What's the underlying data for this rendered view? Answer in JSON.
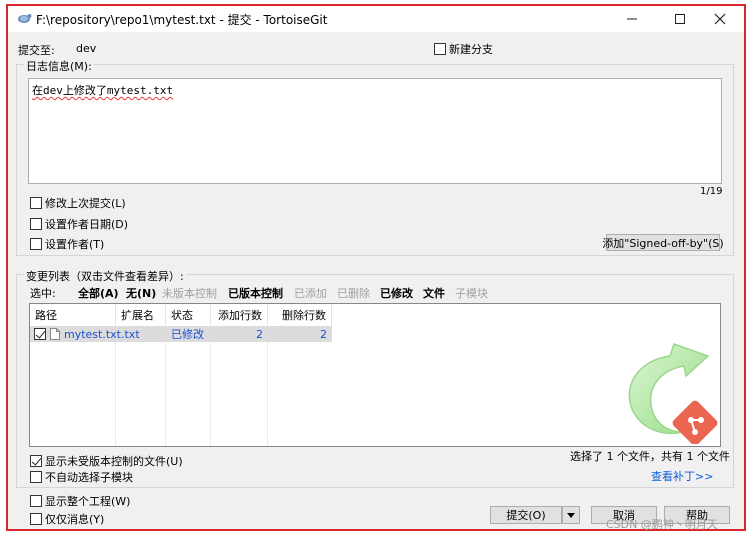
{
  "window": {
    "title": "F:\\repository\\repo1\\mytest.txt - 提交 - TortoiseGit",
    "minimize_label": "",
    "maximize_label": "",
    "close_label": ""
  },
  "commit_to": {
    "label": "提交至:",
    "branch": "dev"
  },
  "new_branch": {
    "label": "新建分支",
    "checked": false
  },
  "log_group": {
    "title": "日志信息(M):",
    "message": "在dev上修改了mytest.txt",
    "counter": "1/19"
  },
  "options_top": [
    {
      "label": "修改上次提交(L)",
      "checked": false
    },
    {
      "label": "设置作者日期(D)",
      "checked": false
    },
    {
      "label": "设置作者(T)",
      "checked": false
    }
  ],
  "signed_off_button": "添加\"Signed-off-by\"(S)",
  "changes_group": {
    "title": "变更列表（双击文件查看差异）:",
    "filter_label": "选中:",
    "filters": [
      {
        "label": "全部(A)",
        "state": "bold"
      },
      {
        "label": "无(N)",
        "state": "bold"
      },
      {
        "label": "未版本控制",
        "state": "disabled"
      },
      {
        "label": "已版本控制",
        "state": "bold"
      },
      {
        "label": "已添加",
        "state": "disabled"
      },
      {
        "label": "已删除",
        "state": "disabled"
      },
      {
        "label": "已修改",
        "state": "bold"
      },
      {
        "label": "文件",
        "state": "bold"
      },
      {
        "label": "子模块",
        "state": "disabled"
      }
    ],
    "columns": [
      "路径",
      "扩展名",
      "状态",
      "添加行数",
      "删除行数"
    ],
    "rows": [
      {
        "path": "mytest.txt",
        "ext": ".txt",
        "status": "已修改",
        "added": "2",
        "deleted": "2",
        "checked": true
      }
    ],
    "show_unversioned": {
      "label": "显示未受版本控制的文件(U)",
      "checked": true
    },
    "no_auto_submodules": {
      "label": "不自动选择子模块",
      "checked": false
    },
    "selection_summary": "选择了 1 个文件，共有 1 个文件",
    "view_patch": "查看补丁>>"
  },
  "options_bottom": [
    {
      "label": "显示整个工程(W)",
      "checked": false
    },
    {
      "label": "仅仅消息(Y)",
      "checked": false
    }
  ],
  "buttons": {
    "commit": "提交(O)",
    "cancel": "取消",
    "help": "帮助"
  },
  "watermark": "CSDN @鹏神丶明月天",
  "colors": {
    "frame_border": "#d9262a",
    "link": "#0b5ed7",
    "modified_status": "#1a4fd6",
    "disabled_text": "#a0a0a0"
  }
}
